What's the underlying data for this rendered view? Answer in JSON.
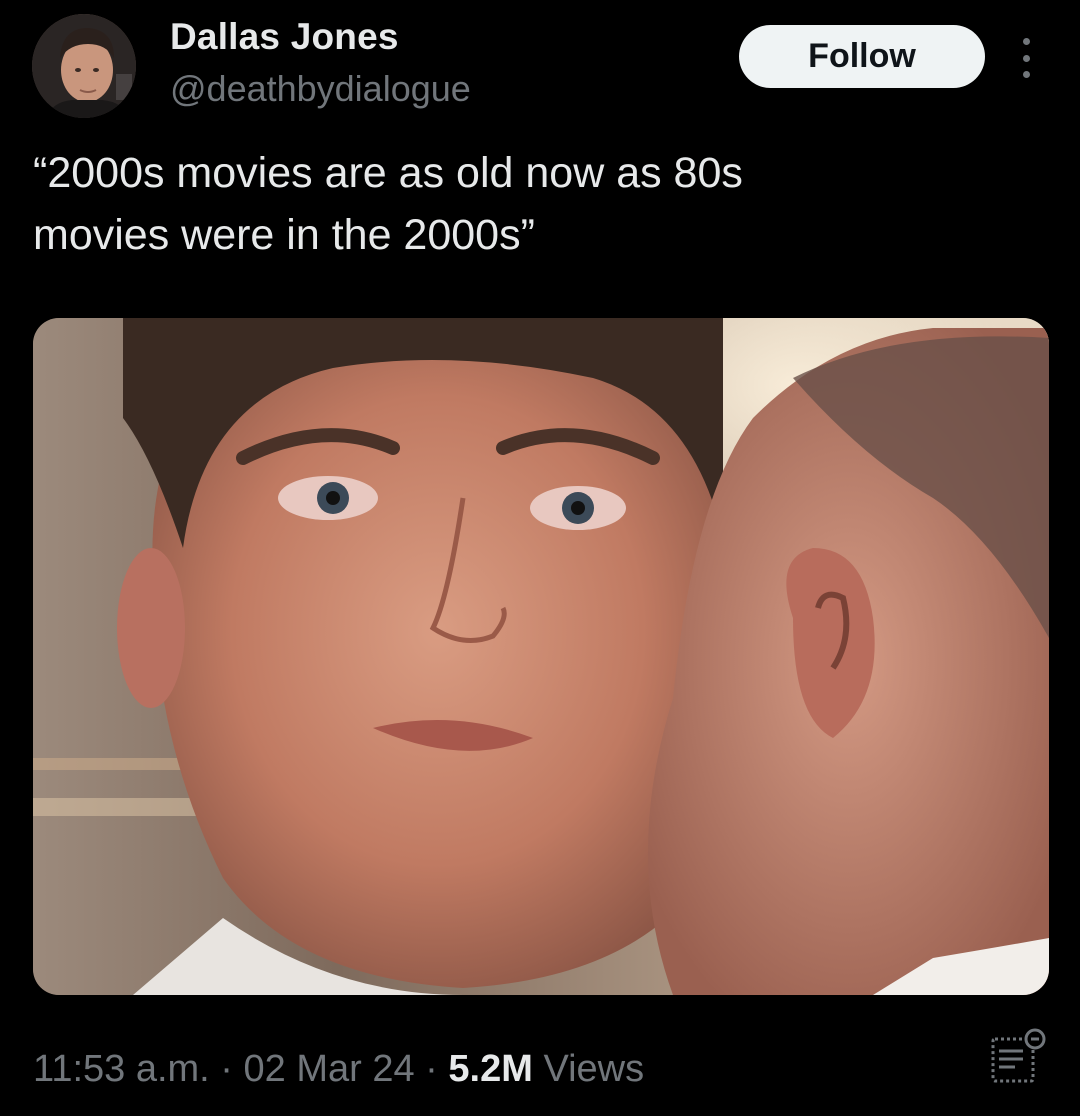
{
  "author": {
    "display_name": "Dallas Jones",
    "handle": "@deathbydialogue",
    "avatar_icon": "profile-photo"
  },
  "actions": {
    "follow_label": "Follow",
    "more_icon": "more-vertical-icon"
  },
  "tweet": {
    "text": "“2000s movies are as old now as 80s\nmovies were in the 2000s”"
  },
  "media": {
    "icon": "movie-still-image"
  },
  "meta": {
    "time": "11:53 a.m.",
    "separator": "·",
    "date": "02 Mar 24",
    "views_count": "5.2M",
    "views_label": "Views"
  },
  "colors": {
    "background": "#000000",
    "primary_text": "#e7e9ea",
    "secondary_text": "#71767b",
    "follow_bg": "#eff3f4",
    "follow_text": "#0f1419"
  }
}
